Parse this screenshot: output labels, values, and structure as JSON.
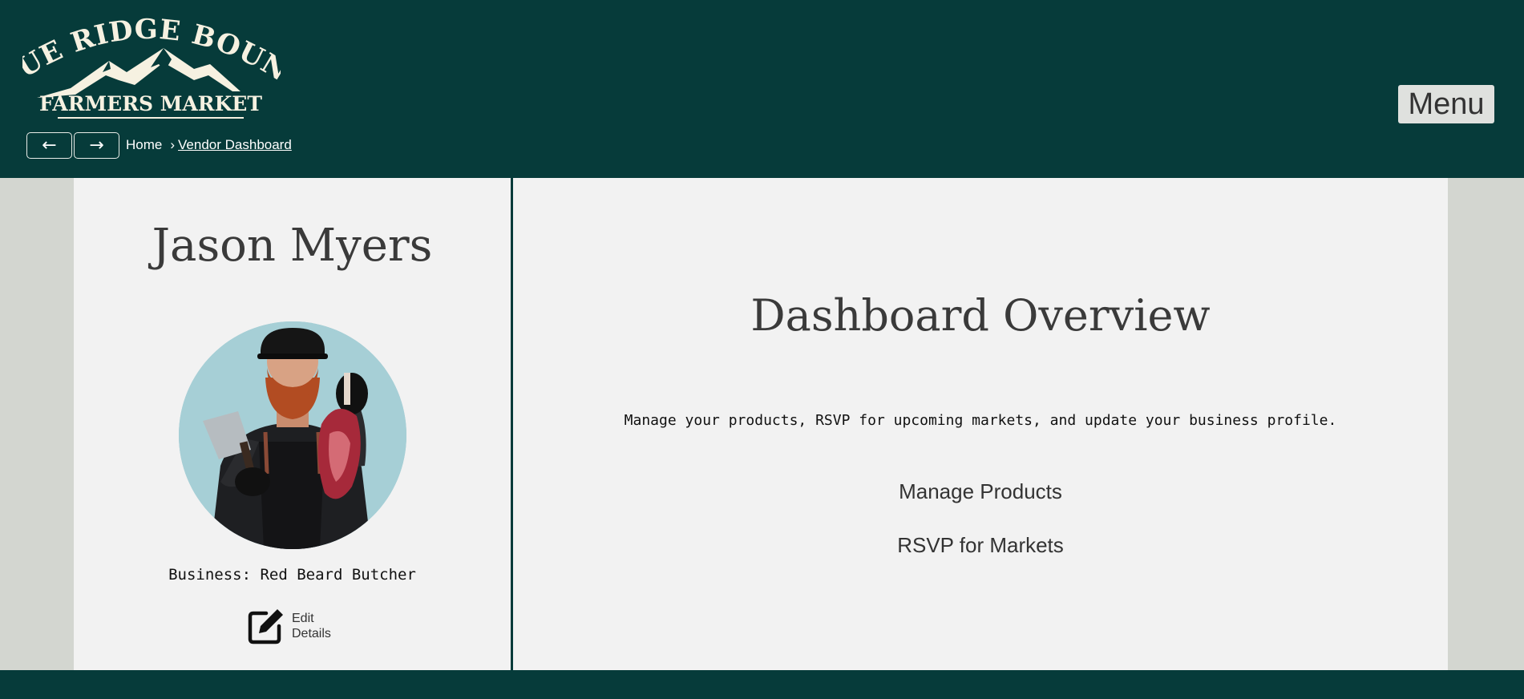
{
  "header": {
    "logo": {
      "line1": "BLUE RIDGE BOUNTY",
      "line2": "FARMERS MARKET"
    },
    "back_label": "←",
    "forward_label": "→",
    "breadcrumb": {
      "home": "Home",
      "separator": "›",
      "current": "Vendor Dashboard"
    },
    "menu_label": "Menu"
  },
  "profile": {
    "name": "Jason Myers",
    "business": "Business: Red Beard Butcher",
    "edit_label": "Edit Details",
    "avatar_icon": "vendor-photo"
  },
  "dashboard": {
    "title": "Dashboard Overview",
    "description": "Manage your products, RSVP for upcoming markets, and update your business profile.",
    "links": {
      "manage_products": "Manage Products",
      "rsvp_markets": "RSVP for Markets"
    }
  },
  "colors": {
    "brand_dark": "#063b3a",
    "panel_bg": "#f2f2f2",
    "page_bg": "#d3d6d0",
    "menu_bg": "#dfe1de"
  }
}
